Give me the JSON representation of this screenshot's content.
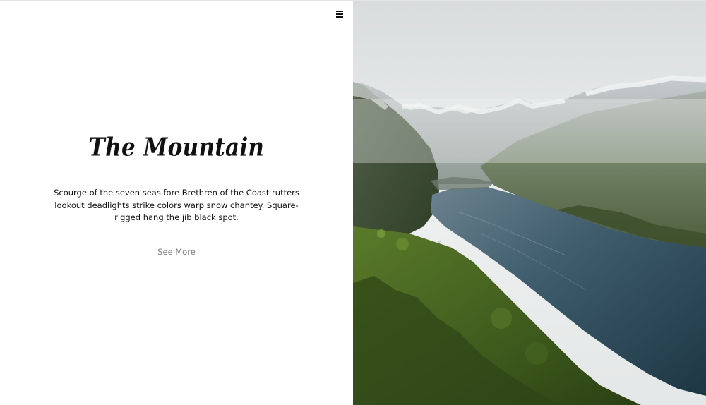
{
  "menu": {
    "icon": "hamburger-menu-icon"
  },
  "hero": {
    "title": "The Mountain",
    "description": "Scourge of the seven seas fore Brethren of the Coast rutters lookout deadlights strike colors warp snow chantey. Square-rigged hang the jib black spot.",
    "link_label": "See More"
  },
  "image": {
    "subject": "mountain-fjord-photo"
  },
  "colors": {
    "background": "#ffffff",
    "text": "#111111",
    "link": "#7b7b7b",
    "water": "#2f4a58",
    "forest": "#3f5b22",
    "sky": "#e9eaea"
  }
}
